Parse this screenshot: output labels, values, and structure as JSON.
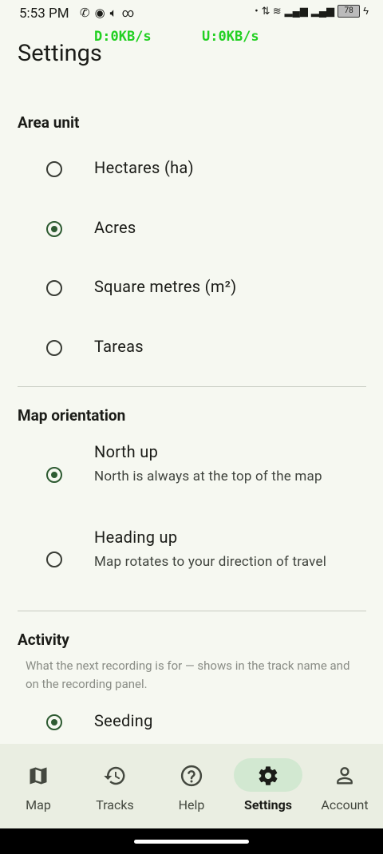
{
  "status": {
    "time": "5:53 PM",
    "battery": "78",
    "download": "D:0KB/s",
    "upload": "U:0KB/s"
  },
  "page": {
    "title": "Settings"
  },
  "area_unit": {
    "title": "Area unit",
    "options": [
      {
        "label": "Hectares (ha)",
        "checked": false
      },
      {
        "label": "Acres",
        "checked": true
      },
      {
        "label": "Square metres (m²)",
        "checked": false
      },
      {
        "label": "Tareas",
        "checked": false
      }
    ]
  },
  "map_orientation": {
    "title": "Map orientation",
    "options": [
      {
        "label": "North up",
        "description": "North is always at the top of the map",
        "checked": true
      },
      {
        "label": "Heading up",
        "description": "Map rotates to your direction of travel",
        "checked": false
      }
    ]
  },
  "activity": {
    "title": "Activity",
    "description": "What the next recording is for — shows in the track name and on the recording panel.",
    "options": [
      {
        "label": "Seeding",
        "checked": true
      }
    ]
  },
  "nav": {
    "items": [
      {
        "label": "Map",
        "icon": "map-icon",
        "active": false
      },
      {
        "label": "Tracks",
        "icon": "history-icon",
        "active": false
      },
      {
        "label": "Help",
        "icon": "help-icon",
        "active": false
      },
      {
        "label": "Settings",
        "icon": "gear-icon",
        "active": true
      },
      {
        "label": "Account",
        "icon": "person-icon",
        "active": false
      }
    ]
  },
  "colors": {
    "accent": "#2e5b32",
    "nav_active_bg": "#d2e8d1",
    "background": "#f6f8f1"
  }
}
